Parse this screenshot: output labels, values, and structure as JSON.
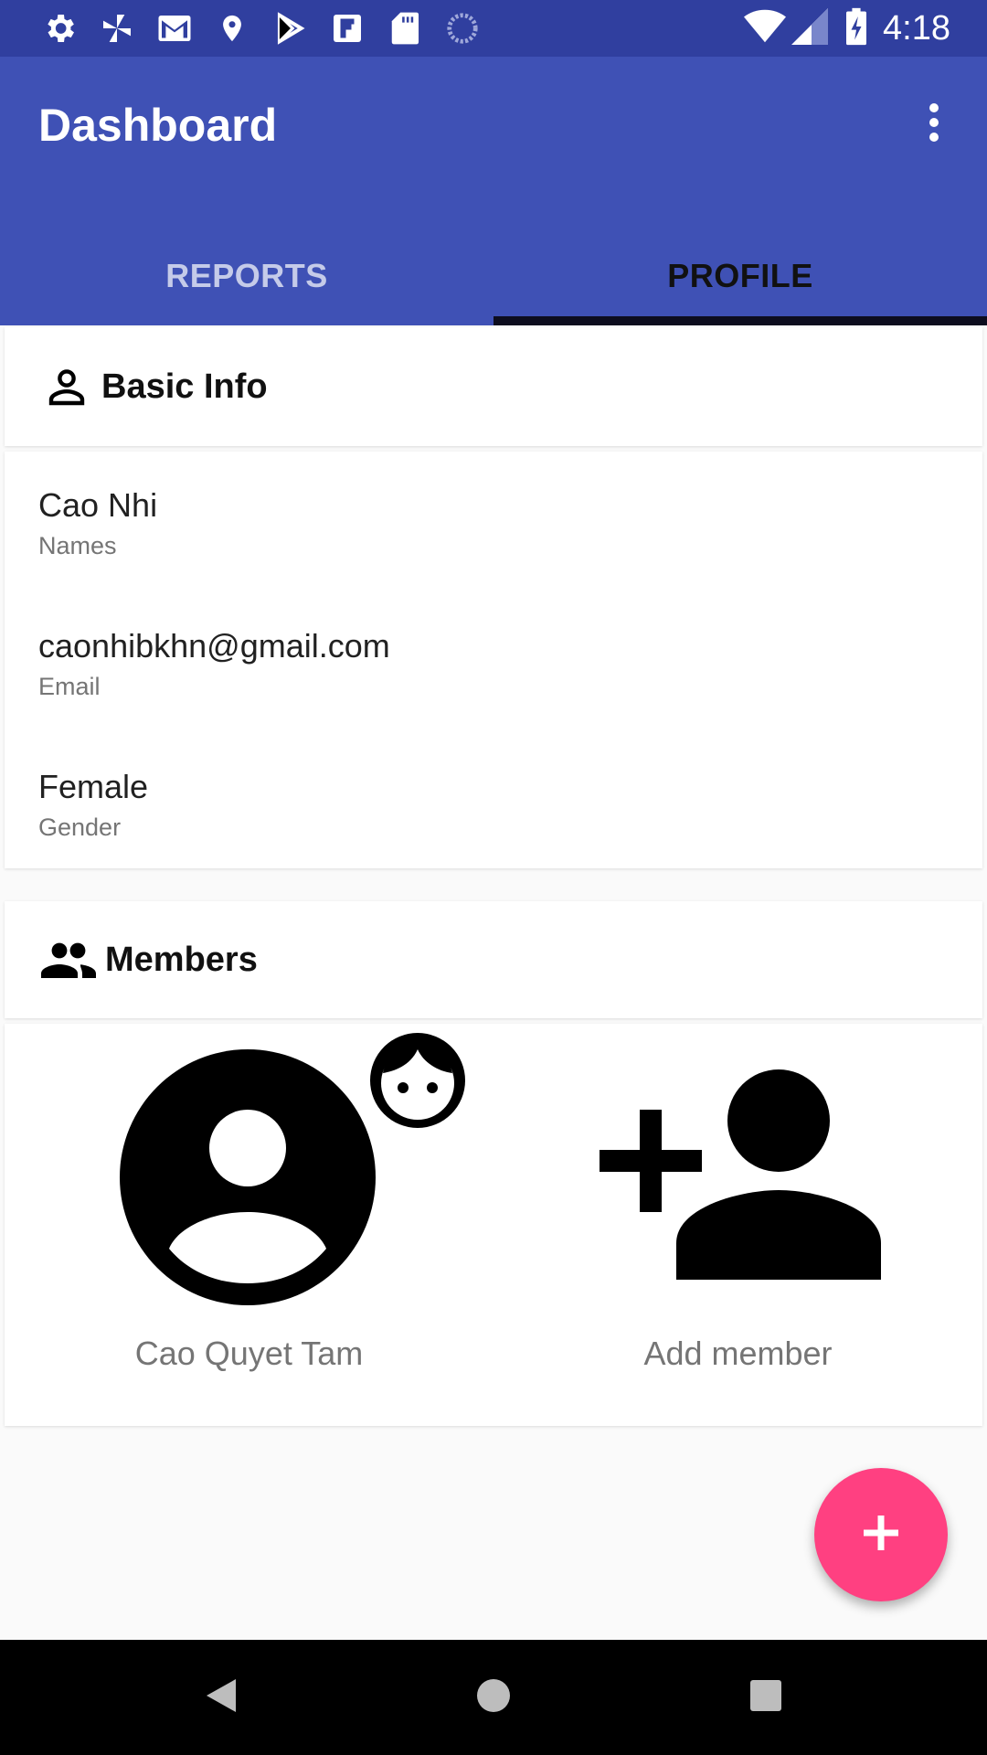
{
  "status_bar": {
    "time": "4:18",
    "icons": [
      "settings-icon",
      "pinwheel-icon",
      "gmail-icon",
      "location-pin-icon",
      "play-store-icon",
      "flipboard-icon",
      "sd-card-icon",
      "loading-circle-icon",
      "wifi-icon",
      "signal-icon",
      "battery-charging-icon"
    ]
  },
  "app_bar": {
    "title": "Dashboard",
    "overflow_icon": "more-vert-icon",
    "color": "#3f51b5"
  },
  "tabs": [
    {
      "label": "REPORTS",
      "active": false
    },
    {
      "label": "PROFILE",
      "active": true
    }
  ],
  "basic_info": {
    "title": "Basic Info",
    "icon": "person-outline-icon",
    "fields": [
      {
        "value": "Cao Nhi",
        "label": "Names"
      },
      {
        "value": "caonhibkhn@gmail.com",
        "label": "Email"
      },
      {
        "value": "Female",
        "label": "Gender"
      }
    ]
  },
  "members": {
    "title": "Members",
    "icon": "people-icon",
    "items": [
      {
        "name": "Cao Quyet Tam",
        "icon": "account-circle-icon",
        "badge": "face-icon"
      },
      {
        "name": "Add member",
        "icon": "person-add-icon"
      }
    ]
  },
  "fab": {
    "icon": "plus-icon",
    "color": "#ff4081"
  },
  "nav_bar": {
    "icons": [
      "back-icon",
      "home-icon",
      "recents-icon"
    ]
  }
}
